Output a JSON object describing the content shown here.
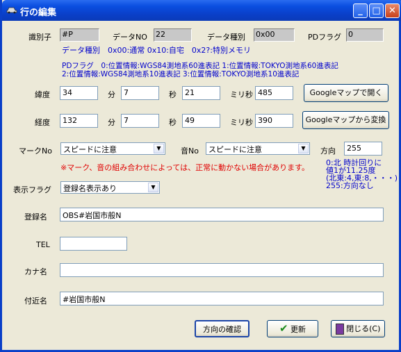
{
  "window": {
    "title": "行の編集"
  },
  "header": {
    "id_label": "識別子",
    "id_value": "#P",
    "datano_label": "データNO",
    "datano_value": "22",
    "datatype_label": "データ種別",
    "datatype_value": "0x00",
    "pdflag_label": "PDフラグ",
    "pdflag_value": "0"
  },
  "notes": {
    "datatype": "データ種別　0x00:通常 0x10:自宅　0x2?:特別メモリ",
    "pdflag_line1": "PDフラグ　0:位置情報:WGS84測地系60進表記 1:位置情報:TOKYO測地系60進表記",
    "pdflag_line2": "2:位置情報:WGS84測地系10進表記 3:位置情報:TOKYO測地系10進表記"
  },
  "latitude": {
    "label": "緯度",
    "deg": "34",
    "min_label": "分",
    "min": "7",
    "sec_label": "秒",
    "sec": "21",
    "ms_label": "ミリ秒",
    "ms": "485"
  },
  "longitude": {
    "label": "経度",
    "deg": "132",
    "min_label": "分",
    "min": "7",
    "sec_label": "秒",
    "sec": "49",
    "ms_label": "ミリ秒",
    "ms": "390"
  },
  "buttons": {
    "open_map": "Googleマップで開く",
    "convert_map": "Googleマップから変換",
    "check_direction": "方向の確認",
    "update": "更新",
    "close": "閉じる(C)"
  },
  "mark": {
    "label": "マークNo",
    "value": "スピードに注意"
  },
  "sound": {
    "label": "音No",
    "value": "スピードに注意"
  },
  "direction": {
    "label": "方向",
    "value": "255",
    "help": [
      "0:北 時計回りに",
      "値1が11.25度",
      "(北東:4,東:8,・・・)",
      "255:方向なし"
    ]
  },
  "warning": "※マーク、音の組み合わせによっては、正常に動かない場合があります。",
  "display_flag": {
    "label": "表示フラグ",
    "value": "登録名表示あり"
  },
  "fields": {
    "reg_name_label": "登録名",
    "reg_name": "OBS#岩国市般N",
    "tel_label": "TEL",
    "tel": "",
    "kana_label": "カナ名",
    "kana": "",
    "near_label": "付近名",
    "near": "#岩国市般N"
  }
}
